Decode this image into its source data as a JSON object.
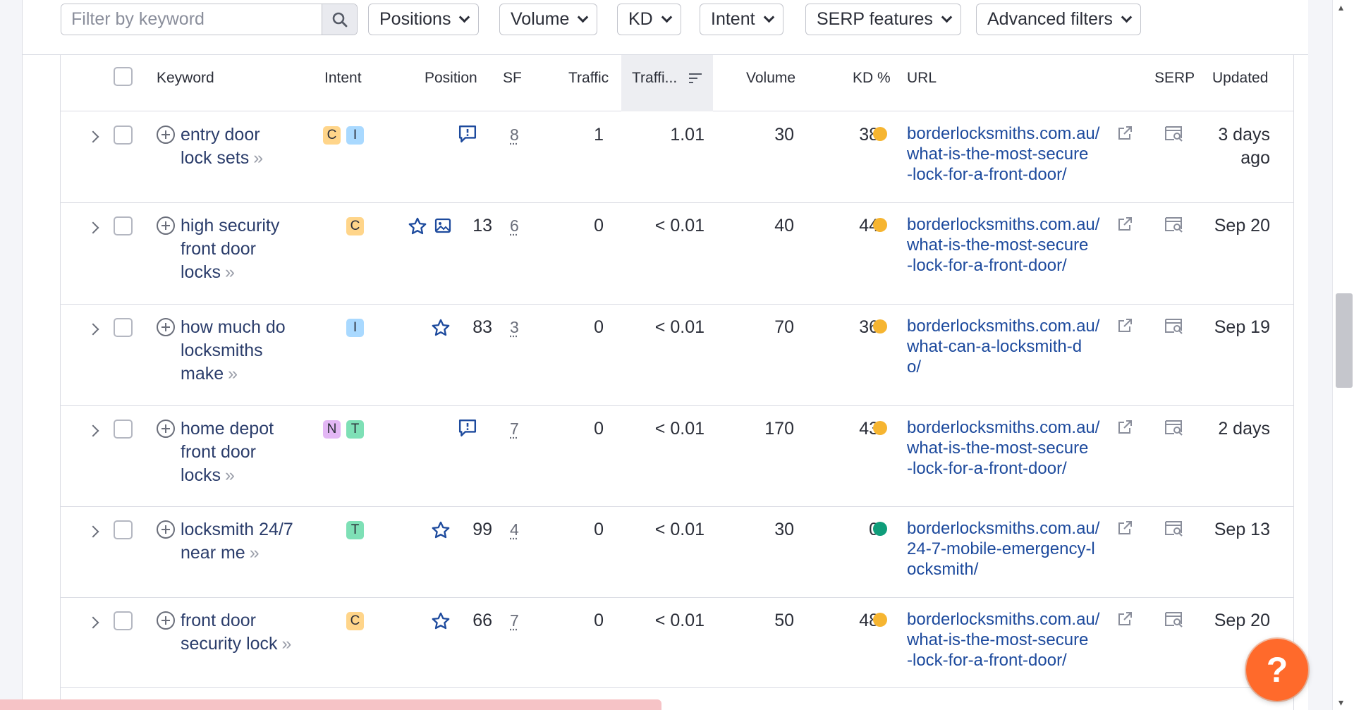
{
  "filters": {
    "search_placeholder": "Filter by keyword",
    "buttons": [
      "Positions",
      "Volume",
      "KD",
      "Intent",
      "SERP features",
      "Advanced filters"
    ]
  },
  "columns": {
    "keyword": "Keyword",
    "intent": "Intent",
    "position": "Position",
    "sf": "SF",
    "traffic": "Traffic",
    "traffic_pct": "Traffi...",
    "volume": "Volume",
    "kd": "KD %",
    "url": "URL",
    "serp": "SERP",
    "updated": "Updated"
  },
  "rows": [
    {
      "keyword_lines": [
        "entry door",
        "lock sets"
      ],
      "intents": [
        "C",
        "I"
      ],
      "position_icon": "serp-review-icon",
      "position": "",
      "sf": "8",
      "traffic": "1",
      "traffic_pct": "1.01",
      "volume": "30",
      "kd": "38",
      "kd_color": "#f6b531",
      "url_lines": [
        "borderlocksmiths.com.au/",
        "what-is-the-most-secure",
        "-lock-for-a-front-door/"
      ],
      "updated_lines": [
        "3 days",
        "ago"
      ]
    },
    {
      "keyword_lines": [
        "high security",
        "front door",
        "locks"
      ],
      "intents": [
        "C"
      ],
      "position_icon": "star-image-icon",
      "position": "13",
      "sf": "6",
      "traffic": "0",
      "traffic_pct": "< 0.01",
      "volume": "40",
      "kd": "44",
      "kd_color": "#f6b531",
      "url_lines": [
        "borderlocksmiths.com.au/",
        "what-is-the-most-secure",
        "-lock-for-a-front-door/"
      ],
      "updated_lines": [
        "Sep 20"
      ]
    },
    {
      "keyword_lines": [
        "how much do",
        "locksmiths",
        "make"
      ],
      "intents": [
        "I"
      ],
      "position_icon": "star-icon",
      "position": "83",
      "sf": "3",
      "traffic": "0",
      "traffic_pct": "< 0.01",
      "volume": "70",
      "kd": "36",
      "kd_color": "#f6b531",
      "url_lines": [
        "borderlocksmiths.com.au/",
        "what-can-a-locksmith-d",
        "o/"
      ],
      "updated_lines": [
        "Sep 19"
      ]
    },
    {
      "keyword_lines": [
        "home depot",
        "front door",
        "locks"
      ],
      "intents": [
        "N",
        "T"
      ],
      "position_icon": "serp-review-icon",
      "position": "",
      "sf": "7",
      "traffic": "0",
      "traffic_pct": "< 0.01",
      "volume": "170",
      "kd": "43",
      "kd_color": "#f6b531",
      "url_lines": [
        "borderlocksmiths.com.au/",
        "what-is-the-most-secure",
        "-lock-for-a-front-door/"
      ],
      "updated_lines": [
        "2 days"
      ]
    },
    {
      "keyword_lines": [
        "locksmith 24/7",
        "near me"
      ],
      "intents": [
        "T"
      ],
      "position_icon": "star-icon",
      "position": "99",
      "sf": "4",
      "traffic": "0",
      "traffic_pct": "< 0.01",
      "volume": "30",
      "kd": "0",
      "kd_color": "#0f9d7a",
      "url_lines": [
        "borderlocksmiths.com.au/",
        "24-7-mobile-emergency-l",
        "ocksmith/"
      ],
      "updated_lines": [
        "Sep 13"
      ]
    },
    {
      "keyword_lines": [
        "front door",
        "security lock"
      ],
      "intents": [
        "C"
      ],
      "position_icon": "star-icon",
      "position": "66",
      "sf": "7",
      "traffic": "0",
      "traffic_pct": "< 0.01",
      "volume": "50",
      "kd": "48",
      "kd_color": "#f6b531",
      "url_lines": [
        "borderlocksmiths.com.au/",
        "what-is-the-most-secure",
        "-lock-for-a-front-door/"
      ],
      "updated_lines": [
        "Sep 20"
      ]
    }
  ],
  "help_button": "?"
}
